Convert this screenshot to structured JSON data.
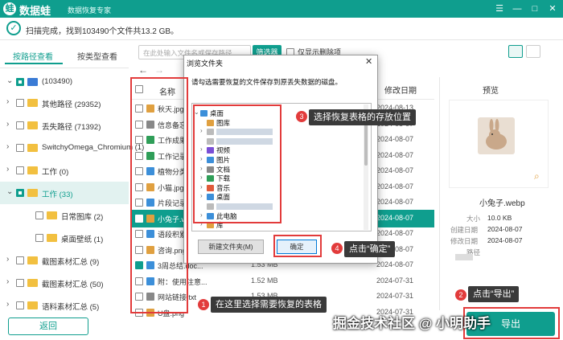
{
  "app": {
    "logo_char": "蛙",
    "name": "数据蛙",
    "subtitle": "数据恢复专家"
  },
  "window_controls": [
    "☰",
    "—",
    "□",
    "✕"
  ],
  "status": {
    "text": "扫描完成，找到103490个文件共13.2 GB。"
  },
  "tabs": {
    "by_path": "按路径查看",
    "by_type": "按类型查看"
  },
  "tree": [
    {
      "label": "(103490)",
      "expand": "⌄"
    },
    {
      "label": "其他路径 (29352)",
      "expand": "›"
    },
    {
      "label": "丢失路径 (71392)",
      "expand": "›"
    },
    {
      "label": "SwitchyOmega_Chromium (1)",
      "expand": "›"
    },
    {
      "label": "工作 (0)",
      "expand": "›"
    },
    {
      "label": "工作 (33)",
      "expand": "⌄"
    },
    {
      "label": "日常图库 (2)",
      "expand": ""
    },
    {
      "label": "桌面壁纸 (1)",
      "expand": ""
    },
    {
      "label": "截图素材汇总 (9)",
      "expand": "›"
    },
    {
      "label": "截图素材汇总 (50)",
      "expand": "›"
    },
    {
      "label": "语料素材汇总 (5)",
      "expand": "›"
    }
  ],
  "back_label": "返回",
  "search": {
    "placeholder": "在此处输入文件名或保存路径",
    "filter_label": "筛选器",
    "only_deleted": "仅显示删除项"
  },
  "list": {
    "name_header": "名称",
    "date_header": "修改日期",
    "rows": [
      {
        "name": "秋天.jpg",
        "date": "2024-08-13",
        "size": ""
      },
      {
        "name": "信息备忘.txt",
        "date": "2024-08-07",
        "size": ""
      },
      {
        "name": "工作成果分...",
        "date": "2024-08-07",
        "size": ""
      },
      {
        "name": "工作记录表...",
        "date": "2024-08-07",
        "size": ""
      },
      {
        "name": "植物分类.d...",
        "date": "2024-08-07",
        "size": ""
      },
      {
        "name": "小猫.jpg",
        "date": "2024-08-07",
        "size": ""
      },
      {
        "name": "片段记录.d...",
        "date": "2024-08-07",
        "size": ""
      },
      {
        "name": "小兔子.webp",
        "date": "2024-08-07",
        "size": ""
      },
      {
        "name": "语段积累.d...",
        "date": "2024-08-07",
        "size": ""
      },
      {
        "name": "咨询.png",
        "date": "2024-08-07",
        "size": ""
      },
      {
        "name": "3周总结.doc...",
        "date": "2024-08-07",
        "size": "1.53 MB"
      },
      {
        "name": "附：使用注意...",
        "date": "2024-07-31",
        "size": "1.52 MB"
      },
      {
        "name": "网站链接.txt",
        "date": "2024-07-31",
        "size": "1.53 MB"
      },
      {
        "name": "U盘.png",
        "date": "2024-07-31",
        "size": ""
      }
    ]
  },
  "preview": {
    "title": "预览",
    "filename": "小兔子.webp",
    "size_key": "大小",
    "size_val": "10.0 KB",
    "created_key": "创建日期",
    "created_val": "2024-08-07",
    "modified_key": "修改日期",
    "modified_val": "2024-08-07",
    "path_key": "路径"
  },
  "export_label": "导出",
  "dialog": {
    "title": "浏览文件夹",
    "close": "✕",
    "desc": "请勾选需要恢复的文件保存到原丢失数据的磁盘。",
    "items": [
      {
        "label": "桌面",
        "indent": 0,
        "expand": "⌄",
        "color": "#3c8fd9"
      },
      {
        "label": "图库",
        "indent": 1,
        "expand": "",
        "color": "#e0a040"
      },
      {
        "label": "",
        "indent": 1,
        "expand": "›",
        "color": "#bbbbbb"
      },
      {
        "label": "",
        "indent": 1,
        "expand": "",
        "color": "#bbbbbb"
      },
      {
        "label": "视频",
        "indent": 1,
        "expand": "›",
        "color": "#7a4fd6"
      },
      {
        "label": "图片",
        "indent": 1,
        "expand": "›",
        "color": "#3c8fd9"
      },
      {
        "label": "文档",
        "indent": 1,
        "expand": "›",
        "color": "#888888"
      },
      {
        "label": "下载",
        "indent": 1,
        "expand": "›",
        "color": "#2f9e58"
      },
      {
        "label": "音乐",
        "indent": 1,
        "expand": "›",
        "color": "#e05a3a"
      },
      {
        "label": "桌面",
        "indent": 1,
        "expand": "›",
        "color": "#3c8fd9"
      },
      {
        "label": "",
        "indent": 1,
        "expand": "",
        "color": "#bbbbbb"
      },
      {
        "label": "此电脑",
        "indent": 1,
        "expand": "›",
        "color": "#3c8fd9"
      },
      {
        "label": "库",
        "indent": 1,
        "expand": "›",
        "color": "#e0a040"
      }
    ],
    "new_folder": "新建文件夹(M)",
    "ok": "确定"
  },
  "callouts": [
    {
      "num": "1",
      "text": "在这里选择需要恢复的表格"
    },
    {
      "num": "2",
      "text": "点击“导出”"
    },
    {
      "num": "3",
      "text": "选择恢复表格的存放位置"
    },
    {
      "num": "4",
      "text": "点击“确定”"
    }
  ],
  "watermark": "掘金技术社区 @ 小明助手",
  "colors": {
    "accent": "#0f9e8e",
    "highlight": "#e23b3b"
  }
}
